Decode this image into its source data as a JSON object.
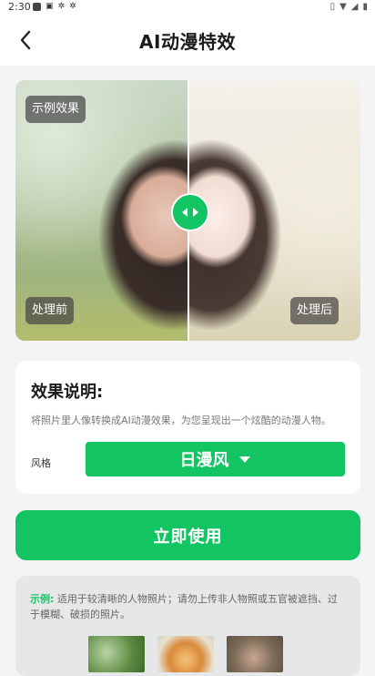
{
  "status_bar": {
    "time": "2:30"
  },
  "header": {
    "title": "AI动漫特效"
  },
  "preview": {
    "example_tag": "示例效果",
    "before_tag": "处理前",
    "after_tag": "处理后"
  },
  "info_card": {
    "heading": "效果说明:",
    "description": "将照片里人像转换成AI动漫效果，为您呈现出一个炫酷的动漫人物。",
    "style_label": "风格",
    "style_value": "日漫风"
  },
  "primary_button": {
    "label": "立即使用"
  },
  "example_note": {
    "lead": "示例:",
    "text": "适用于较清晰的人物照片；请勿上传非人物照或五官被遮挡、过于模糊、破损的照片。"
  },
  "colors": {
    "accent": "#13c463",
    "background": "#f3f4f5"
  }
}
